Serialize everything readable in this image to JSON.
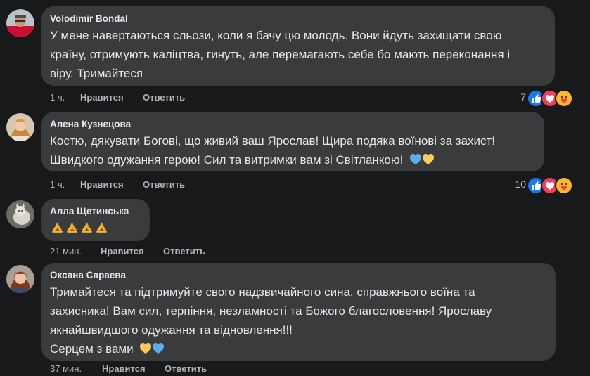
{
  "comments": [
    {
      "author": "Volodimir Bondal",
      "lines": [
        "У мене навертаються сльози, коли я бачу цю молодь. Вони йдуть захищати свою",
        "країну, отримують каліцтва, гинуть, але перемагають себе бо мають переконання і",
        "віру. Тримайтеся"
      ],
      "time": "1 ч.",
      "like_label": "Нравится",
      "reply_label": "Ответить",
      "reaction_count": "7",
      "reactions": [
        "like-icon",
        "love-icon",
        "care-icon"
      ]
    },
    {
      "author": "Алена Кузнецова",
      "lines": [
        "Костю, дякувати Богові, що живий ваш Ярослав! Щира подяка воїнові за захист!",
        "Швидкого одужання герою! Сил та витримки вам зі Світланкою!"
      ],
      "trailing_emoji": [
        "blue-heart",
        "yellow-heart"
      ],
      "time": "1 ч.",
      "like_label": "Нравится",
      "reply_label": "Ответить",
      "reaction_count": "10",
      "reactions": [
        "like-icon",
        "love-icon",
        "care-icon"
      ]
    },
    {
      "author": "Алла Щетинська",
      "emoji_line": [
        "folded-hands",
        "folded-hands",
        "folded-hands",
        "folded-hands"
      ],
      "time": "21 мин.",
      "like_label": "Нравится",
      "reply_label": "Ответить"
    },
    {
      "author": "Оксана Сараева",
      "lines": [
        "Тримайтеся та підтримуйте свого надзвичайного сина, справжнього воїна та",
        "захисника! Вам сил, терпіння, незламності та Божого благословення! Ярославу",
        "якнайшвидшого одужання та відновлення!!!",
        "Серцем з вами"
      ],
      "trailing_emoji": [
        "yellow-heart",
        "blue-heart"
      ],
      "time": "37 мин.",
      "like_label": "Нравится",
      "reply_label": "Ответить"
    }
  ],
  "colors": {
    "background": "#18191a",
    "bubble": "#3a3b3c",
    "text": "#e4e6eb",
    "secondary_text": "#b0b3b8",
    "like_blue": "#1877f2",
    "love_red": "#f33e58",
    "care_yellow": "#f7b928"
  }
}
